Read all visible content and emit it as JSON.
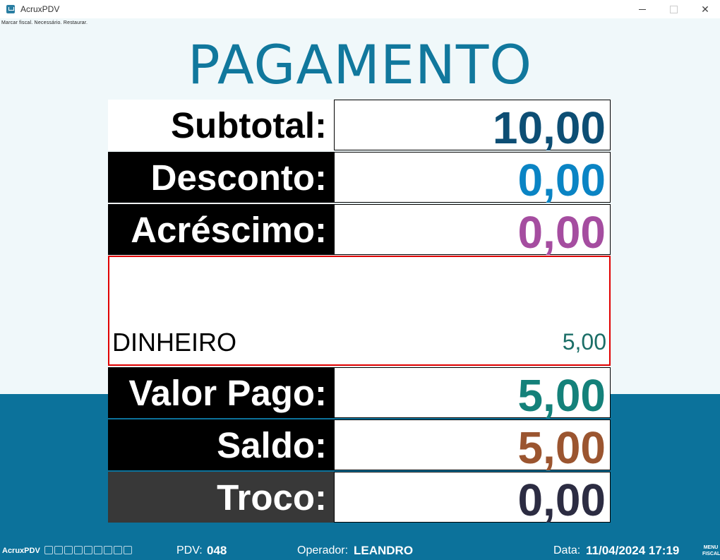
{
  "window": {
    "title": "AcruxPDV",
    "minimize_glyph": "minimize-icon",
    "maximize_glyph": "maximize-icon",
    "close_label": "✕"
  },
  "notice": "Marcar fiscal. Necessário. Restaurar.",
  "heading": "PAGAMENTO",
  "rows": {
    "subtotal": {
      "label": "Subtotal:",
      "value": "10,00",
      "label_bg": "#ffffff",
      "label_color": "#000000",
      "value_color": "#0d4e74"
    },
    "desconto": {
      "label": "Desconto:",
      "value": "0,00",
      "label_bg": "#000000",
      "label_color": "#ffffff",
      "value_color": "#0a84c4"
    },
    "acrescimo": {
      "label": "Acréscimo:",
      "value": "0,00",
      "label_bg": "#000000",
      "label_color": "#ffffff",
      "value_color": "#a54da0"
    },
    "valor_pago": {
      "label": "Valor Pago:",
      "value": "5,00",
      "label_bg": "#000000",
      "label_color": "#ffffff",
      "value_color": "#14817a"
    },
    "saldo": {
      "label": "Saldo:",
      "value": "5,00",
      "label_bg": "#000000",
      "label_color": "#ffffff",
      "value_color": "#9b5530"
    },
    "troco": {
      "label": "Troco:",
      "value": "0,00",
      "label_bg": "#383838",
      "label_color": "#ffffff",
      "value_color": "#2c2c42"
    }
  },
  "payments": [
    {
      "method": "DINHEIRO",
      "amount": "5,00"
    }
  ],
  "statusbar": {
    "app": "AcruxPDV",
    "pdv_label": "PDV:",
    "pdv_value": "048",
    "operador_label": "Operador:",
    "operador_value": "LEANDRO",
    "data_label": "Data:",
    "data_value": "11/04/2024 17:19",
    "menu_fiscal_line1": "MENU",
    "menu_fiscal_line2": "FISCAL",
    "icons": [
      "network-icon",
      "monitor-icon",
      "printer-icon",
      "scale-icon",
      "keyboard-icon",
      "shield-icon",
      "user-icon",
      "store-icon",
      "grid-icon"
    ]
  },
  "colors": {
    "heading": "#11789d",
    "top_background": "#f0f8fa",
    "bottom_background": "#0c729b",
    "payment_border": "#e00000"
  }
}
